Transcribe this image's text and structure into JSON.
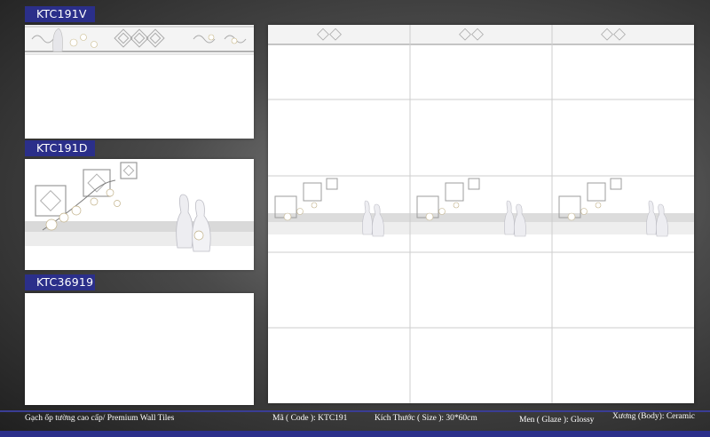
{
  "products": [
    {
      "code": "KTC191V"
    },
    {
      "code": "KTC191D"
    },
    {
      "code": "KTC36919"
    }
  ],
  "footer": {
    "category": "Gạch ốp tường cao cấp/ Premium Wall Tiles",
    "code": "Mã ( Code ): KTC191",
    "size": "Kích Thước ( Size ): 30*60cm",
    "glaze": "Men ( Glaze ): Glossy",
    "body": "Xương (Body): Ceramic"
  },
  "colors": {
    "label_bg": "#2b2f8a",
    "tile": "#ffffff",
    "accent_gray": "#c8c8c8"
  }
}
